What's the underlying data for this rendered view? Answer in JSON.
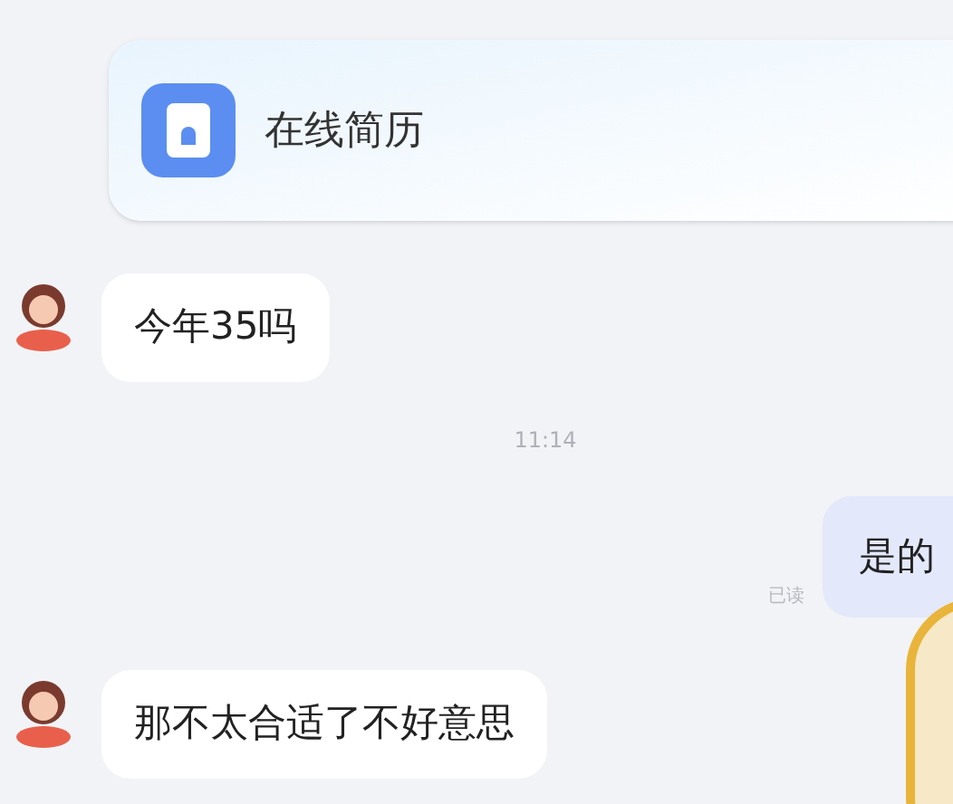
{
  "messages": [
    {
      "kind": "card",
      "text": "在线简历"
    },
    {
      "kind": "received",
      "text": "今年35吗"
    },
    {
      "kind": "time",
      "text": "11:14"
    },
    {
      "kind": "sent",
      "text": "是的",
      "status": "已读"
    },
    {
      "kind": "received",
      "text": "那不太合适了不好意思"
    }
  ]
}
